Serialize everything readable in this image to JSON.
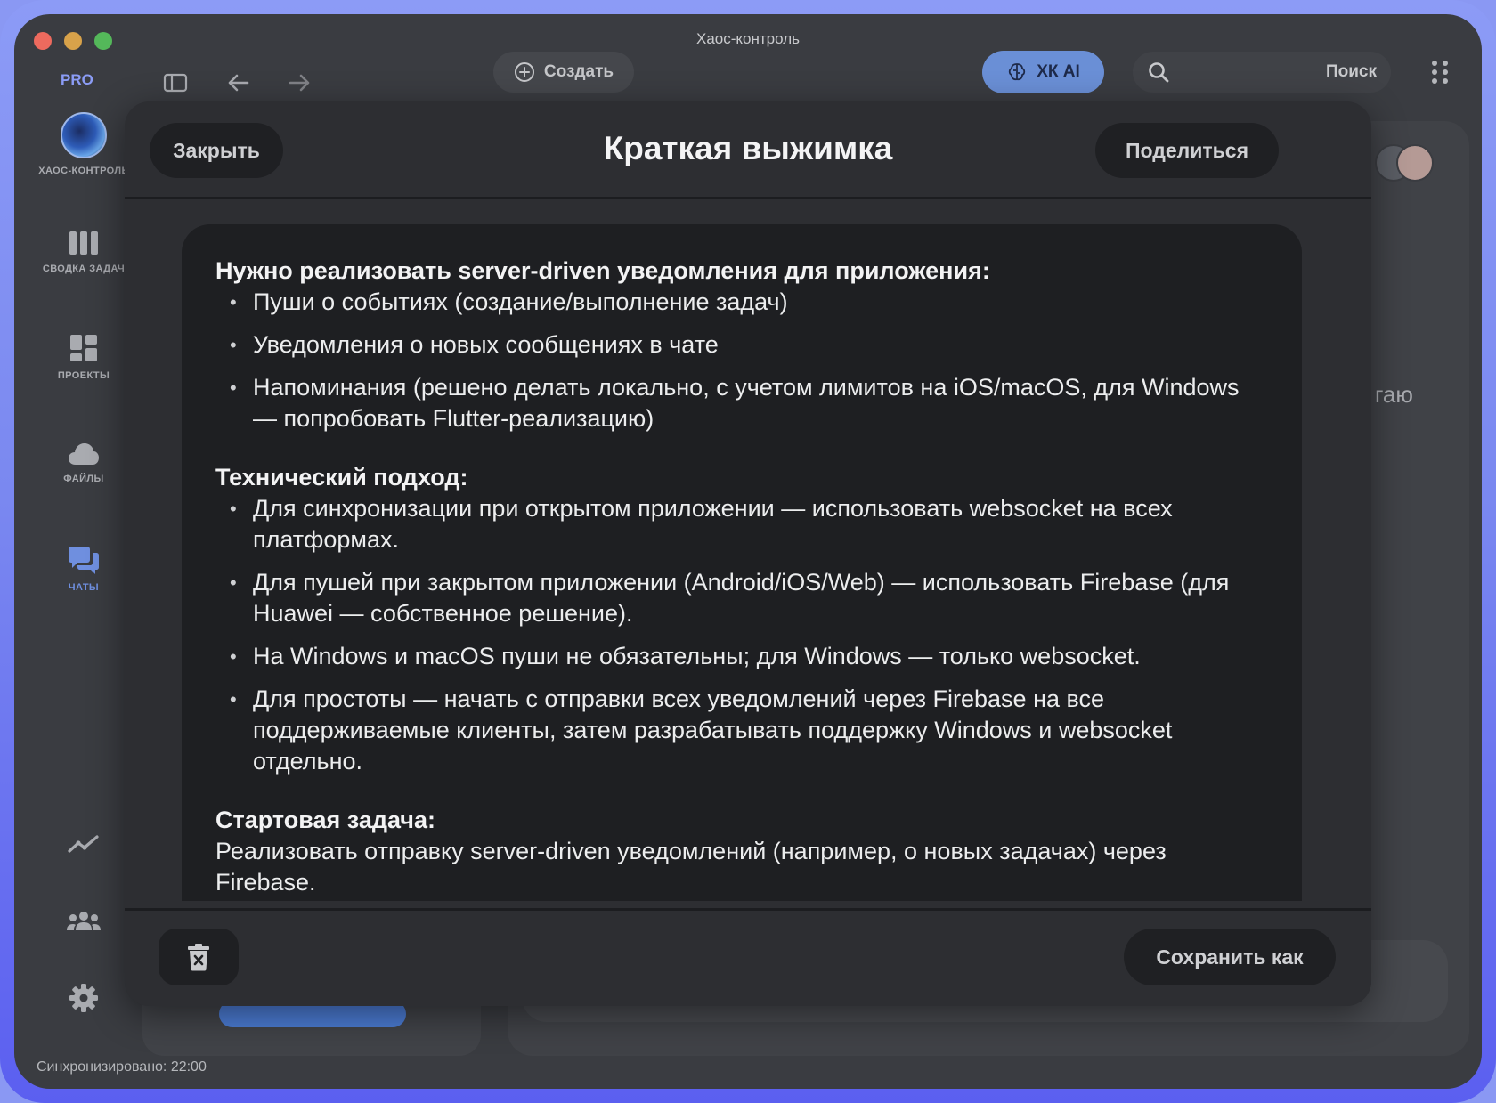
{
  "window": {
    "title": "Хаос-контроль"
  },
  "toolbar": {
    "pro_badge": "PRO",
    "create_label": "Создать",
    "ai_label": "ХК AI",
    "search_label": "Поиск"
  },
  "sidebar": {
    "brand": "ХАОС-КОНТРОЛЬ",
    "items": [
      {
        "label": "СВОДКА ЗАДАЧ",
        "icon": "columns-icon"
      },
      {
        "label": "ПРОЕКТЫ",
        "icon": "dashboard-icon"
      },
      {
        "label": "ФАЙЛЫ",
        "icon": "cloud-icon"
      },
      {
        "label": "ЧАТЫ",
        "icon": "chat-icon",
        "active": true
      }
    ],
    "bottom_icons": [
      "analytics-icon",
      "team-icon",
      "settings-icon"
    ],
    "sync_status": "Синхронизировано: 22:00"
  },
  "background": {
    "partial_text": "гаю"
  },
  "modal": {
    "close_label": "Закрыть",
    "title": "Краткая выжимка",
    "share_label": "Поделиться",
    "save_label": "Сохранить как",
    "sections": {
      "s1": {
        "heading": "Нужно реализовать server-driven уведомления для приложения:",
        "items": [
          "Пуши о событиях (создание/выполнение задач)",
          "Уведомления о новых сообщениях в чате",
          "Напоминания (решено делать локально, с учетом лимитов на iOS/macOS, для Windows — попробовать Flutter-реализацию)"
        ]
      },
      "s2": {
        "heading": "Технический подход:",
        "items": [
          "Для синхронизации при открытом приложении — использовать websocket на всех платформах.",
          "Для пушей при закрытом приложении (Android/iOS/Web) — использовать Firebase (для Huawei — собственное решение).",
          "На Windows и macOS пуши не обязательны; для Windows — только websocket.",
          "Для простоты — начать с отправки всех уведомлений через Firebase на все поддерживаемые клиенты, затем разрабатывать поддержку Windows и websocket отдельно."
        ]
      },
      "s3": {
        "heading": "Стартовая задача:",
        "text": "Реализовать отправку server-driven уведомлений (например, о новых задачах) через Firebase."
      }
    }
  },
  "colors": {
    "accent": "#6a8fd6",
    "active_nav": "#6f8fdf",
    "window_bg": "#3a3c41",
    "modal_bg": "#2d2e32",
    "card_bg": "#1e1f22"
  }
}
